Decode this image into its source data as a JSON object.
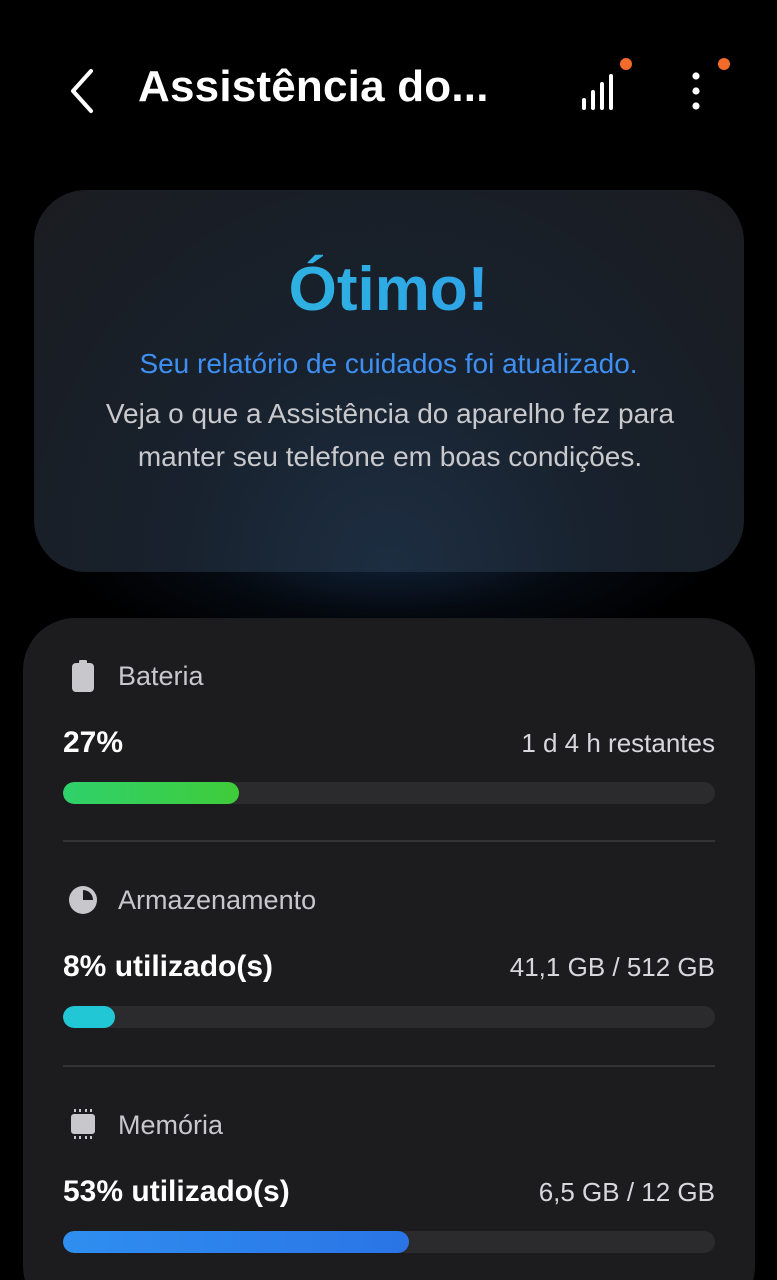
{
  "header": {
    "title": "Assistência do...",
    "back_icon": "chevron-left-icon",
    "signal_icon": "signal-bars-icon",
    "more_icon": "more-vertical-icon",
    "badge_color": "#f26b2a"
  },
  "hero": {
    "status": "Ótimo!",
    "link_text": "Seu relatório de cuidados foi atualizado.",
    "description": "Veja o que a Assistência do aparelho fez para manter seu telefone em boas condições.",
    "status_gradient": [
      "#2ec7d9",
      "#2f8ef0"
    ],
    "link_color": "#3e8ff2"
  },
  "stats": [
    {
      "icon": "battery-icon",
      "label": "Bateria",
      "value": "27%",
      "detail": "1 d 4 h restantes",
      "progress": 0.27,
      "bar_colors": [
        "#2fd16b",
        "#3fcc3a"
      ]
    },
    {
      "icon": "pie-chart-icon",
      "label": "Armazenamento",
      "value": "8% utilizado(s)",
      "detail": "41,1 GB / 512 GB",
      "progress": 0.08,
      "bar_colors": [
        "#22c7d6",
        "#22c7d6"
      ]
    },
    {
      "icon": "memory-chip-icon",
      "label": "Memória",
      "value": "53% utilizado(s)",
      "detail": "6,5 GB / 12 GB",
      "progress": 0.53,
      "bar_colors": [
        "#2f8ef0",
        "#2a74e6"
      ]
    }
  ]
}
